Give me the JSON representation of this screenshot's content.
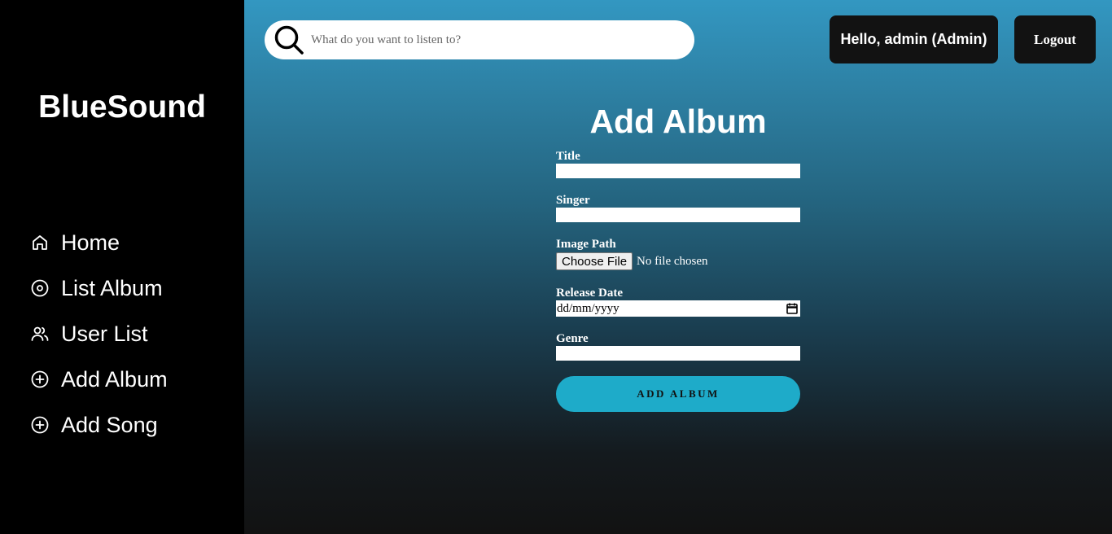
{
  "sidebar": {
    "brand": "BlueSound",
    "items": [
      {
        "label": "Home",
        "icon": "home-icon"
      },
      {
        "label": "List Album",
        "icon": "disc-icon"
      },
      {
        "label": "User List",
        "icon": "users-icon"
      },
      {
        "label": "Add Album",
        "icon": "plus-circle-icon"
      },
      {
        "label": "Add Song",
        "icon": "plus-circle-icon"
      }
    ]
  },
  "header": {
    "search_placeholder": "What do you want to listen to?",
    "greeting": "Hello, admin (Admin)",
    "logout_label": "Logout"
  },
  "form": {
    "title": "Add Album",
    "fields": {
      "title_label": "Title",
      "singer_label": "Singer",
      "image_label": "Image Path",
      "file_button": "Choose File",
      "file_status": "No file chosen",
      "date_label": "Release Date",
      "date_placeholder": "dd/mm/yyyy",
      "genre_label": "Genre"
    },
    "submit_label": "ADD ALBUM"
  },
  "colors": {
    "sidebar_bg": "#000000",
    "gradient_top": "#3397c1",
    "gradient_bottom": "#121212",
    "button_accent": "#1eabc9",
    "header_buttons": "#121212"
  }
}
